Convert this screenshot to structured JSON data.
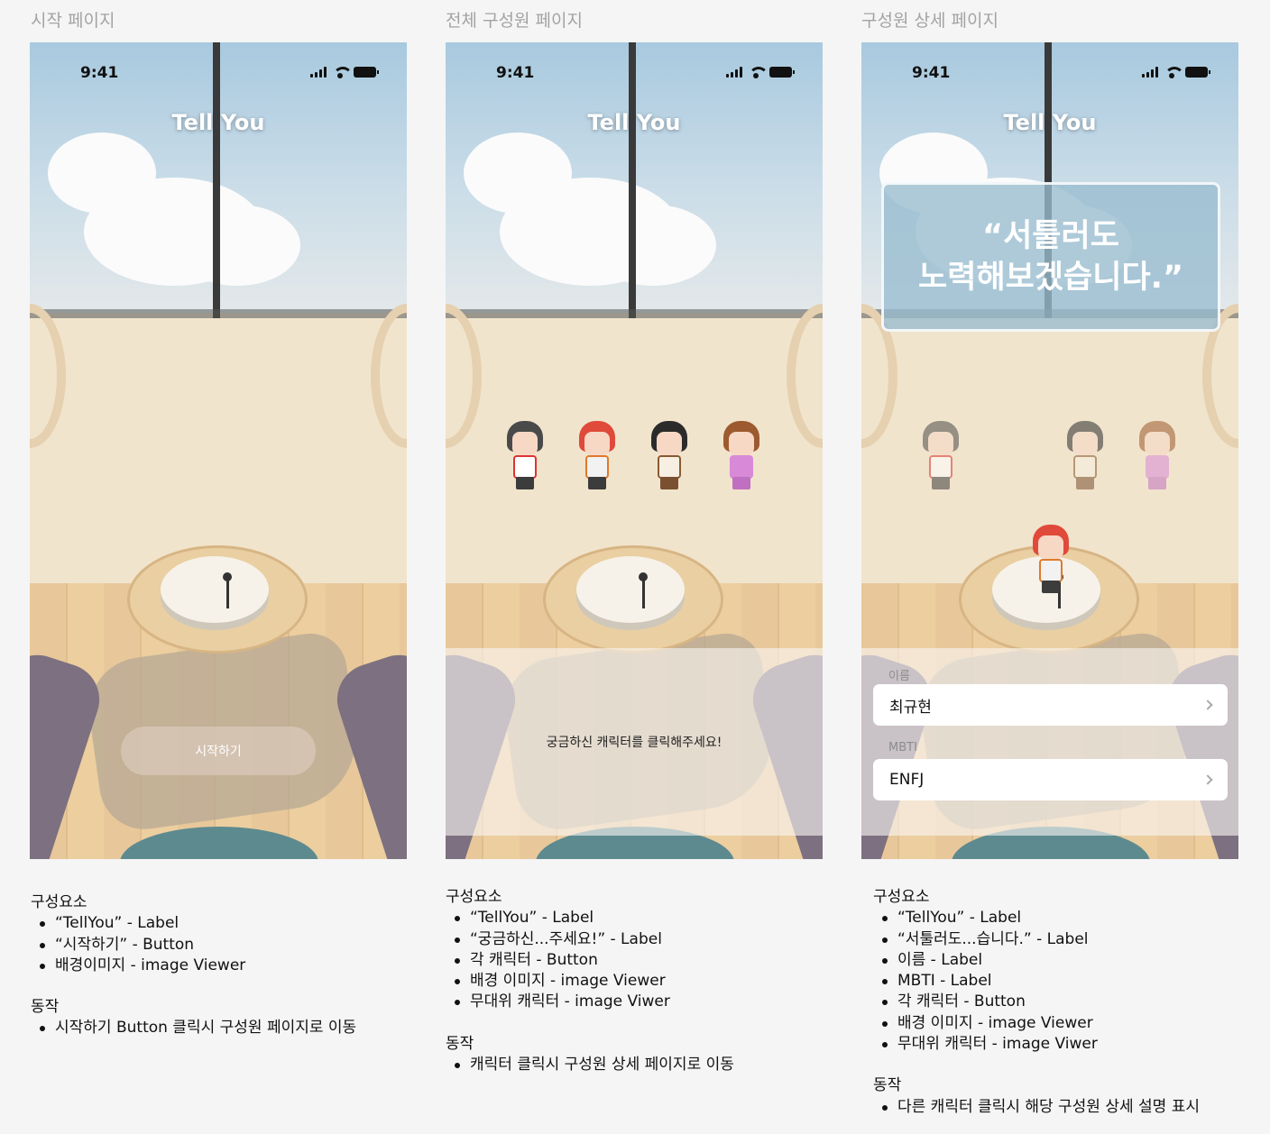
{
  "columns": [
    {
      "title": "시작 페이지",
      "status_time": "9:41",
      "app_title": "Tell You",
      "start_button": "시작하기",
      "notes": {
        "components_title": "구성요소",
        "components": [
          "“TellYou” - Label",
          "“시작하기” - Button",
          "배경이미지 - image Viewer"
        ],
        "actions_title": "동작",
        "actions": [
          "시작하기 Button 클릭시 구성원 페이지로 이동"
        ]
      }
    },
    {
      "title": "전체 구성원 페이지",
      "status_time": "9:41",
      "app_title": "Tell You",
      "hint": "궁금하신 캐릭터를 클릭해주세요!",
      "notes": {
        "components_title": "구성요소",
        "components": [
          "“TellYou” - Label",
          "“궁금하신...주세요!” - Label",
          "각 캐릭터 - Button",
          "배경 이미지 - image Viewer",
          "무대위 캐릭터 -  image Viwer"
        ],
        "actions_title": "동작",
        "actions": [
          "캐릭터 클릭시 구성원 상세 페이지로 이동"
        ]
      }
    },
    {
      "title": "구성원 상세 페이지",
      "status_time": "9:41",
      "app_title": "Tell You",
      "quote_line1": "“서툴러도",
      "quote_line2": "노력해보겠습니다.”",
      "name_label": "이름",
      "name_value": "최규현",
      "mbti_label": "MBTI",
      "mbti_value": "ENFJ",
      "notes": {
        "components_title": "구성요소",
        "components": [
          "“TellYou” - Label",
          "“서툴러도...습니다.” - Label",
          "이름 - Label",
          "MBTI - Label",
          "각 캐릭터 - Button",
          "배경 이미지 - image Viewer",
          "무대위 캐릭터 -  image Viwer"
        ],
        "actions_title": "동작",
        "actions": [
          "다른 캐릭터 클릭시 해당 구성원 상세 설명 표시"
        ]
      }
    }
  ]
}
